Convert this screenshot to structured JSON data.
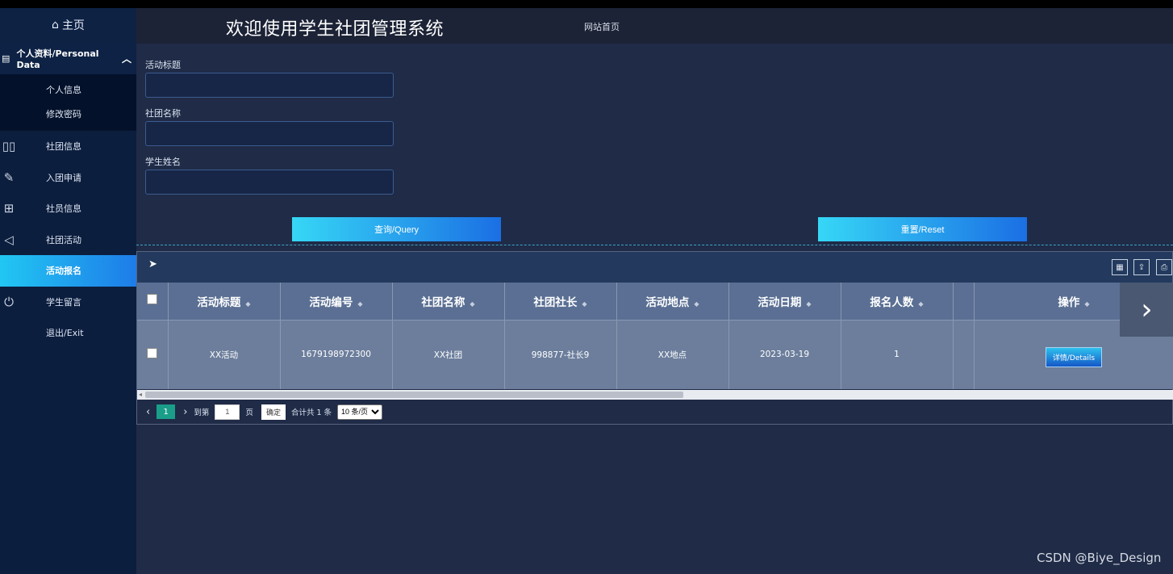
{
  "sidebar": {
    "home": "主页",
    "group_label": "个人资料/Personal Data",
    "sub_items": [
      "个人信息",
      "修改密码"
    ],
    "items": [
      {
        "label": "社团信息",
        "icon": "book-icon"
      },
      {
        "label": "入团申请",
        "icon": "ruler-icon"
      },
      {
        "label": "社员信息",
        "icon": "grid-search-icon"
      },
      {
        "label": "社团活动",
        "icon": "send-icon"
      },
      {
        "label": "活动报名",
        "icon": "none",
        "active": true
      },
      {
        "label": "学生留言",
        "icon": "power-icon"
      },
      {
        "label": "退出/Exit",
        "icon": "none"
      }
    ]
  },
  "header": {
    "title": "欢迎使用学生社团管理系统",
    "home_link": "网站首页"
  },
  "form": {
    "activity_title_label": "活动标题",
    "club_name_label": "社团名称",
    "student_name_label": "学生姓名",
    "query_button": "查询/Query",
    "reset_button": "重置/Reset"
  },
  "table": {
    "headers": [
      "活动标题",
      "活动编号",
      "社团名称",
      "社团社长",
      "活动地点",
      "活动日期",
      "报名人数",
      "操作"
    ],
    "rows": [
      {
        "title": "XX活动",
        "id": "1679198972300",
        "club": "XX社团",
        "leader": "998877-社长9",
        "place": "XX地点",
        "date": "2023-03-19",
        "count": "1",
        "action": "详情/Details"
      }
    ]
  },
  "pager": {
    "current_page": "1",
    "goto_label": "到第",
    "goto_value": "1",
    "page_unit": "页",
    "confirm": "确定",
    "total": "合计共 1 条",
    "page_size": "10 条/页"
  },
  "watermark": "CSDN @Biye_Design",
  "colors": {
    "accent_start": "#36d7f6",
    "accent_end": "#1b6fe4",
    "sidebar_bg": "#0c1e3e",
    "main_bg": "#1f2b47"
  }
}
